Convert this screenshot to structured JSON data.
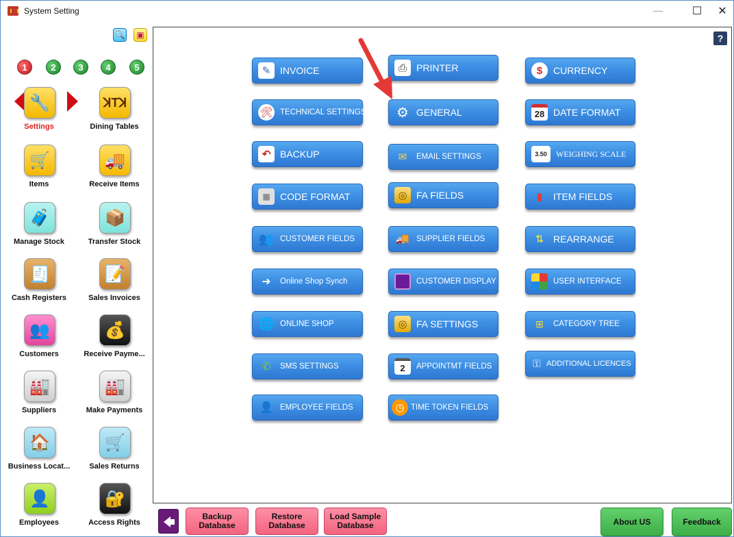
{
  "window": {
    "title": "System Setting",
    "controls": {
      "minimize": "—",
      "maximize": "☐",
      "close": "✕"
    }
  },
  "sidebar": {
    "top_icons": [
      "search-icon",
      "window-icon"
    ],
    "step_badges": [
      "1",
      "2",
      "3",
      "4",
      "5"
    ],
    "items": [
      {
        "label": "Settings",
        "icon": "tools-icon",
        "active": true
      },
      {
        "label": "Dining Tables",
        "icon": "dining-table-icon"
      },
      {
        "label": "Items",
        "icon": "cart-icon"
      },
      {
        "label": "Receive Items",
        "icon": "truck-icon"
      },
      {
        "label": "Manage Stock",
        "icon": "trolley-icon"
      },
      {
        "label": "Transfer Stock",
        "icon": "box-transfer-icon"
      },
      {
        "label": "Cash Registers",
        "icon": "cash-register-icon"
      },
      {
        "label": "Sales Invoices",
        "icon": "invoice-icon"
      },
      {
        "label": "Customers",
        "icon": "people-icon"
      },
      {
        "label": "Receive Payme...",
        "icon": "money-in-icon"
      },
      {
        "label": "Suppliers",
        "icon": "factory-icon"
      },
      {
        "label": "Make Payments",
        "icon": "factory-pay-icon"
      },
      {
        "label": "Business Locat...",
        "icon": "store-icon"
      },
      {
        "label": "Sales Returns",
        "icon": "cart-return-icon"
      },
      {
        "label": "Employees",
        "icon": "person-icon"
      },
      {
        "label": "Access Rights",
        "icon": "lock-key-icon"
      }
    ]
  },
  "main": {
    "help": "?",
    "buttons": [
      {
        "label": "INVOICE",
        "icon": "invoice-icon"
      },
      {
        "label": "PRINTER",
        "icon": "printer-icon"
      },
      {
        "label": "CURRENCY",
        "icon": "currency-icon"
      },
      {
        "label": "TECHNICAL SETTINGS",
        "icon": "technical-icon"
      },
      {
        "label": "GENERAL",
        "icon": "gear-icon"
      },
      {
        "label": "DATE FORMAT",
        "icon": "calendar-icon",
        "icon_text": "28"
      },
      {
        "label": "BACKUP",
        "icon": "undo-icon"
      },
      {
        "label": "EMAIL SETTINGS",
        "icon": "email-icon"
      },
      {
        "label": "WEIGHING SCALE",
        "icon": "scale-icon",
        "icon_text": "3.50"
      },
      {
        "label": "CODE FORMAT",
        "icon": "barcode-icon"
      },
      {
        "label": "FA FIELDS",
        "icon": "coins-icon"
      },
      {
        "label": "ITEM FIELDS",
        "icon": "item-fields-icon"
      },
      {
        "label": "CUSTOMER FIELDS",
        "icon": "customers-icon"
      },
      {
        "label": "SUPPLIER FIELDS",
        "icon": "truck-icon"
      },
      {
        "label": "REARRANGE",
        "icon": "rearrange-icon"
      },
      {
        "label": "Online Shop Synch",
        "icon": "sync-icon"
      },
      {
        "label": "CUSTOMER DISPLAY",
        "icon": "display-icon"
      },
      {
        "label": "USER INTERFACE",
        "icon": "ui-icon"
      },
      {
        "label": "ONLINE SHOP",
        "icon": "globe-icon"
      },
      {
        "label": "FA SETTINGS",
        "icon": "coins-icon"
      },
      {
        "label": "CATEGORY TREE",
        "icon": "tree-icon"
      },
      {
        "label": "SMS SETTINGS",
        "icon": "sms-icon"
      },
      {
        "label": "APPOINTMT FIELDS",
        "icon": "calendar-icon",
        "icon_text": "2"
      },
      {
        "label": "ADDITIONAL LICENCES",
        "icon": "key-icon"
      },
      {
        "label": "EMPLOYEE FIELDS",
        "icon": "person-icon"
      },
      {
        "label": "TIME TOKEN FIELDS",
        "icon": "clock-icon"
      }
    ]
  },
  "bottom": {
    "back": "back-icon",
    "backup": "Backup Database",
    "restore": "Restore Database",
    "load_sample": "Load Sample Database",
    "about": "About US",
    "feedback": "Feedback"
  }
}
